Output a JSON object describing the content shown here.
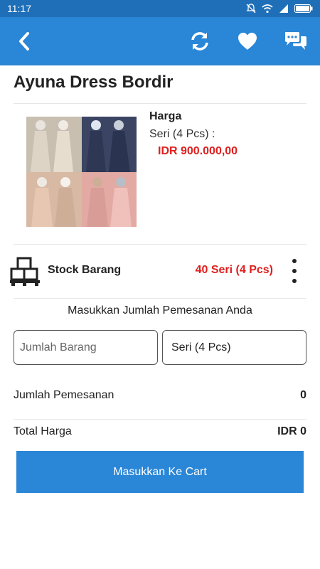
{
  "status_bar": {
    "time": "11:17"
  },
  "header": {
    "back_icon": "back-arrow-icon",
    "refresh_icon": "refresh-icon",
    "favorite_icon": "heart-icon",
    "chat_icon": "chat-icon",
    "bar_color": "#2a86d6"
  },
  "product": {
    "title": "Ayuna Dress Bordir",
    "price_label": "Harga",
    "price_unit": "Seri (4 Pcs)  :",
    "price_value": "IDR 900.000,00"
  },
  "stock": {
    "label": "Stock Barang",
    "value": "40 Seri (4 Pcs)"
  },
  "order": {
    "prompt": "Masukkan Jumlah Pemesanan Anda",
    "qty_placeholder": "Jumlah Barang",
    "unit_selected": "Seri (4 Pcs)",
    "jumlah_label": "Jumlah Pemesanan",
    "jumlah_value": "0",
    "total_label": "Total Harga",
    "total_value": "IDR 0"
  },
  "cart_button": {
    "label": "Masukkan Ke Cart"
  },
  "colors": {
    "accent": "#2a86d6",
    "price_red": "#e01e1e"
  }
}
